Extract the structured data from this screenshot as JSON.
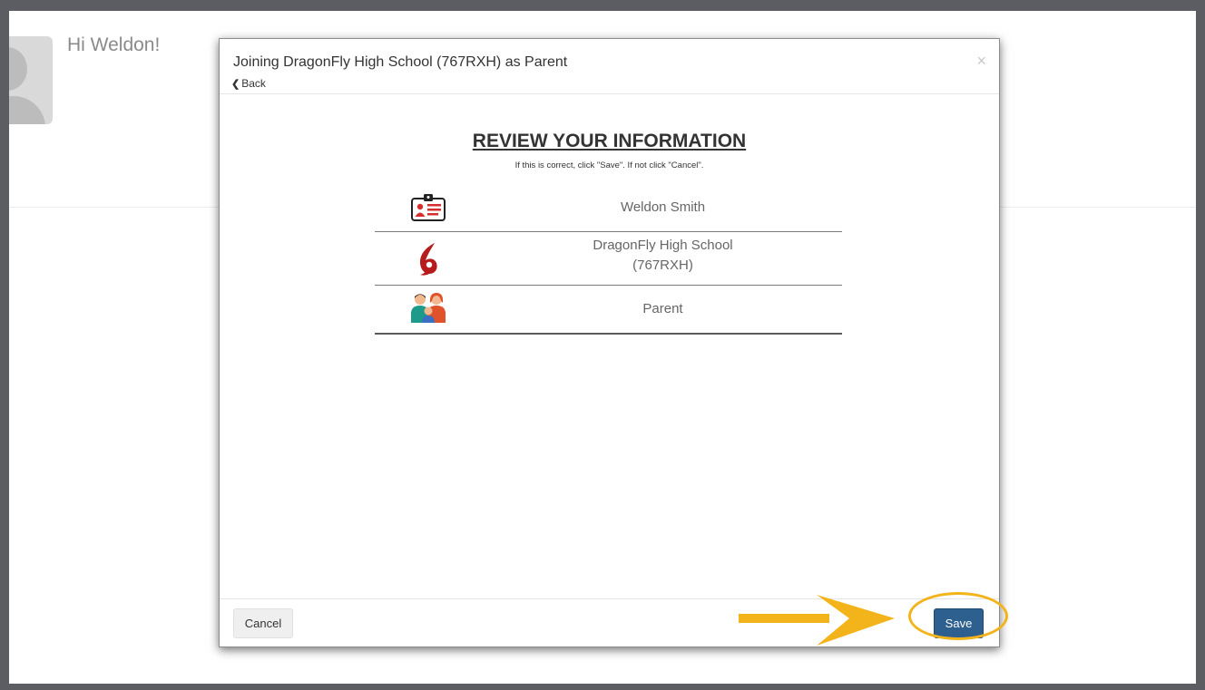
{
  "page": {
    "greeting": "Hi Weldon!"
  },
  "modal": {
    "title": "Joining DragonFly High School (767RXH) as Parent",
    "back_label": "Back",
    "close_label": "×",
    "heading": "REVIEW YOUR INFORMATION",
    "instructions": "If this is correct, click \"Save\". If not click \"Cancel\".",
    "rows": [
      {
        "icon": "id-card-icon",
        "label": "Weldon Smith"
      },
      {
        "icon": "school-logo-icon",
        "label_line1": "DragonFly High School",
        "label_line2": "(767RXH)"
      },
      {
        "icon": "family-icon",
        "label": "Parent"
      }
    ],
    "cancel_label": "Cancel",
    "save_label": "Save"
  },
  "colors": {
    "save_button": "#2d5f8f",
    "highlight": "#f3b41b",
    "school_logo": "#b71c1c"
  }
}
